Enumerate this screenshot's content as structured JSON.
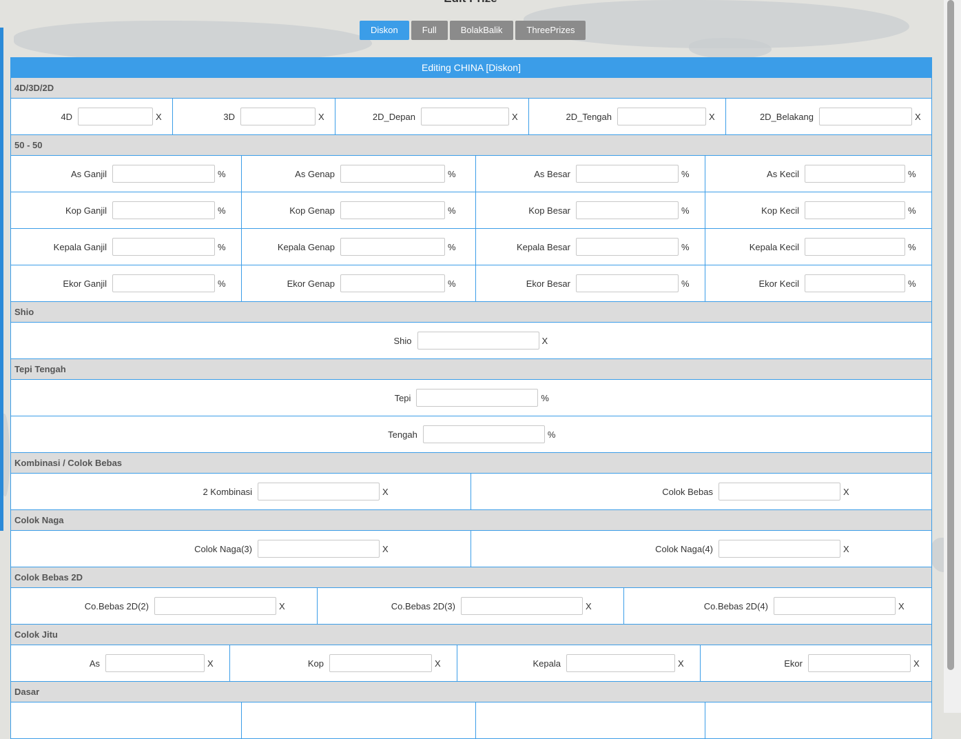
{
  "page_title": "Edit Prize",
  "tabs": [
    {
      "label": "Diskon"
    },
    {
      "label": "Full"
    },
    {
      "label": "BolakBalik"
    },
    {
      "label": "ThreePrizes"
    }
  ],
  "panel_title": "Editing CHINA [Diskon]",
  "sections": {
    "s4d": {
      "title": "4D/3D/2D",
      "f": [
        {
          "label": "4D",
          "unit": "X"
        },
        {
          "label": "3D",
          "unit": "X"
        },
        {
          "label": "2D_Depan",
          "unit": "X"
        },
        {
          "label": "2D_Tengah",
          "unit": "X"
        },
        {
          "label": "2D_Belakang",
          "unit": "X"
        }
      ]
    },
    "s5050": {
      "title": "50 - 50",
      "rows": [
        [
          {
            "label": "As Ganjil",
            "unit": "%"
          },
          {
            "label": "As Genap",
            "unit": "%"
          },
          {
            "label": "As Besar",
            "unit": "%"
          },
          {
            "label": "As Kecil",
            "unit": "%"
          }
        ],
        [
          {
            "label": "Kop Ganjil",
            "unit": "%"
          },
          {
            "label": "Kop Genap",
            "unit": "%"
          },
          {
            "label": "Kop Besar",
            "unit": "%"
          },
          {
            "label": "Kop Kecil",
            "unit": "%"
          }
        ],
        [
          {
            "label": "Kepala Ganjil",
            "unit": "%"
          },
          {
            "label": "Kepala Genap",
            "unit": "%"
          },
          {
            "label": "Kepala Besar",
            "unit": "%"
          },
          {
            "label": "Kepala Kecil",
            "unit": "%"
          }
        ],
        [
          {
            "label": "Ekor Ganjil",
            "unit": "%"
          },
          {
            "label": "Ekor Genap",
            "unit": "%"
          },
          {
            "label": "Ekor Besar",
            "unit": "%"
          },
          {
            "label": "Ekor Kecil",
            "unit": "%"
          }
        ]
      ]
    },
    "shio": {
      "title": "Shio",
      "f": [
        {
          "label": "Shio",
          "unit": "X"
        }
      ]
    },
    "tepi": {
      "title": "Tepi Tengah",
      "f": [
        {
          "label": "Tepi",
          "unit": "%"
        },
        {
          "label": "Tengah",
          "unit": "%"
        }
      ]
    },
    "komb": {
      "title": "Kombinasi / Colok Bebas",
      "f": [
        {
          "label": "2 Kombinasi",
          "unit": "X"
        },
        {
          "label": "Colok Bebas",
          "unit": "X"
        }
      ]
    },
    "naga": {
      "title": "Colok Naga",
      "f": [
        {
          "label": "Colok Naga(3)",
          "unit": "X"
        },
        {
          "label": "Colok Naga(4)",
          "unit": "X"
        }
      ]
    },
    "cb2d": {
      "title": "Colok Bebas 2D",
      "f": [
        {
          "label": "Co.Bebas 2D(2)",
          "unit": "X"
        },
        {
          "label": "Co.Bebas 2D(3)",
          "unit": "X"
        },
        {
          "label": "Co.Bebas 2D(4)",
          "unit": "X"
        }
      ]
    },
    "jitu": {
      "title": "Colok Jitu",
      "f": [
        {
          "label": "As",
          "unit": "X"
        },
        {
          "label": "Kop",
          "unit": "X"
        },
        {
          "label": "Kepala",
          "unit": "X"
        },
        {
          "label": "Ekor",
          "unit": "X"
        }
      ]
    },
    "dasar": {
      "title": "Dasar"
    }
  }
}
